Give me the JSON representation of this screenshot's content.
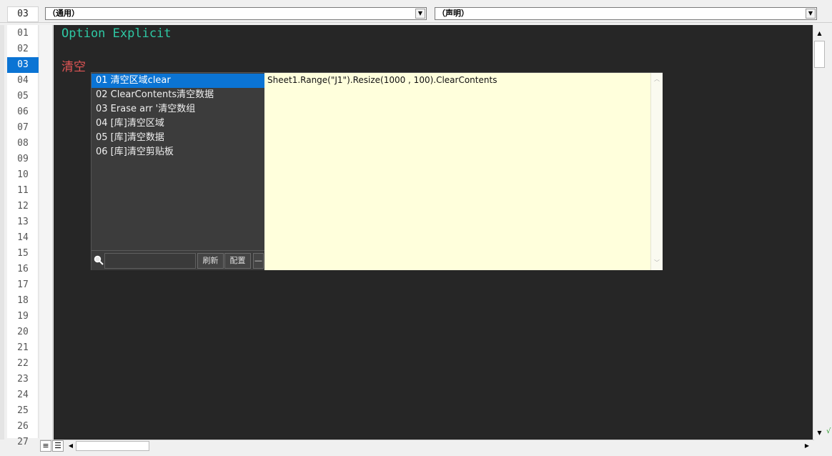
{
  "header": {
    "current_line": "03",
    "object_combo": "（通用）",
    "proc_combo": "（声明）"
  },
  "gutter": {
    "lines": [
      "01",
      "02",
      "03",
      "04",
      "05",
      "06",
      "07",
      "08",
      "09",
      "10",
      "11",
      "12",
      "13",
      "14",
      "15",
      "16",
      "17",
      "18",
      "19",
      "20",
      "21",
      "22",
      "23",
      "24",
      "25",
      "26",
      "27"
    ],
    "active_line": "03"
  },
  "editor": {
    "code_lines": [
      "Option Explicit",
      "",
      "清空"
    ]
  },
  "popup": {
    "items": [
      "01 清空区域clear",
      "02 ClearContents清空数据",
      "03 Erase arr '清空数组",
      "04 [库]清空区域",
      "05 [库]清空数据",
      "06 [库]清空剪贴板"
    ],
    "selected_index": 0,
    "search_placeholder": "",
    "refresh_label": "刷新",
    "config_label": "配置",
    "minus_label": "—",
    "preview_text": "Sheet1.Range(\"J1\").Resize(1000 , 100).ClearContents"
  },
  "icons": {
    "combo_arrow": "chevron-down-icon",
    "search": "search-icon",
    "scroll_up": "arrow-up-icon",
    "scroll_down": "arrow-down-icon",
    "scroll_left": "arrow-left-icon",
    "scroll_right": "arrow-right-icon",
    "procedure_view": "procedure-view-icon",
    "full_module_view": "full-module-view-icon"
  },
  "colors": {
    "editor_bg": "#262626",
    "keyword": "#2ec8a4",
    "typed_text": "#e05555",
    "selection": "#0b74d4",
    "preview_bg": "#ffffdc"
  }
}
